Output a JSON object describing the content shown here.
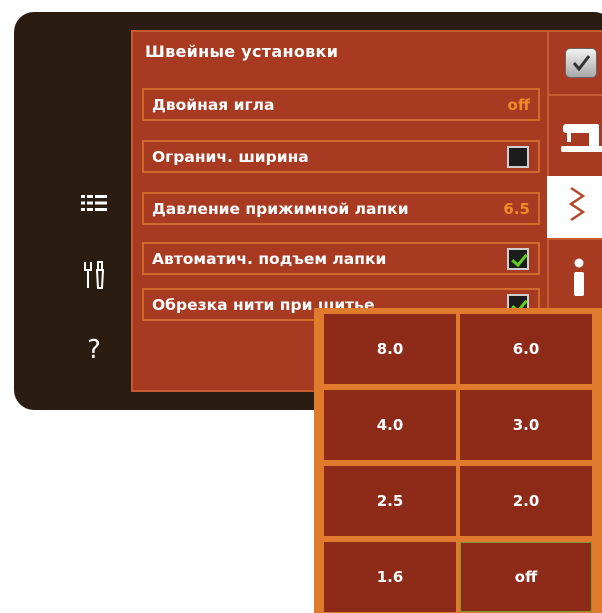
{
  "panel": {
    "title": "Швейные установки",
    "rows": [
      {
        "label": "Двойная игла",
        "value": "off"
      },
      {
        "label": "Огранич. ширина",
        "checked": false
      },
      {
        "label": "Давление прижимной лапки",
        "value": "6.5"
      },
      {
        "label": "Автоматич. подъем лапки",
        "checked": true
      },
      {
        "label": "Обрезка нити при шитье",
        "checked": true
      }
    ]
  },
  "left_icons": [
    "settings-list-icon",
    "tools-icon",
    "help-icon"
  ],
  "left_help_glyph": "?",
  "right_tabs": [
    "confirm-check-icon",
    "sewing-machine-icon",
    "stitch-zigzag-icon",
    "info-icon"
  ],
  "popup": {
    "options": [
      "8.0",
      "6.0",
      "4.0",
      "3.0",
      "2.5",
      "2.0",
      "1.6",
      "off"
    ],
    "selected": "off"
  },
  "colors": {
    "panel_bg": "#a93a22",
    "accent": "#f08a2a",
    "frame": "#2a1c10",
    "check": "#5fd01c"
  }
}
